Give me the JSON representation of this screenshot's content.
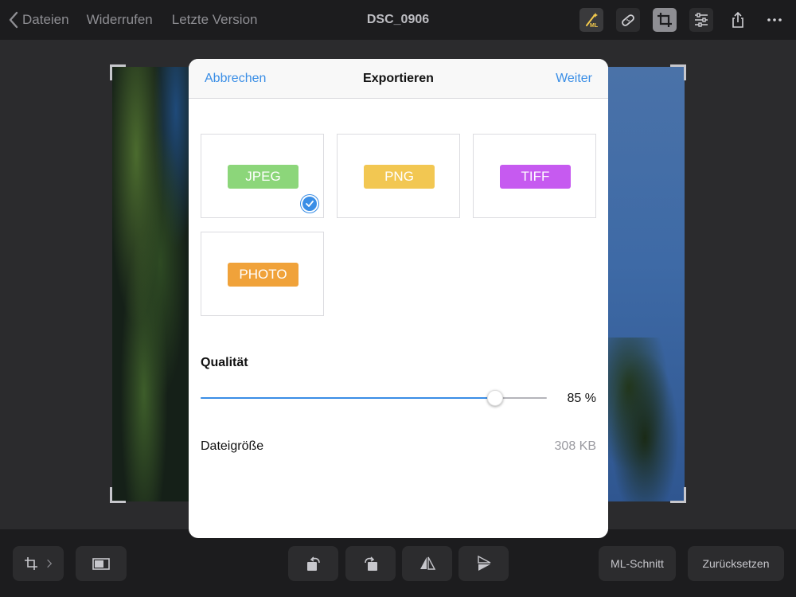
{
  "topbar": {
    "back_label": "Dateien",
    "undo_label": "Widerrufen",
    "version_label": "Letzte Version",
    "title": "DSC_0906",
    "icons": [
      "magic-ml-icon",
      "bandage-icon",
      "crop-icon",
      "adjustments-icon",
      "share-icon",
      "more-icon"
    ],
    "ml_badge": "ML"
  },
  "bottombar": {
    "ml_cut_label": "ML-Schnitt",
    "reset_label": "Zurücksetzen"
  },
  "modal": {
    "cancel_label": "Abbrechen",
    "title": "Exportieren",
    "next_label": "Weiter",
    "formats": [
      {
        "label": "JPEG",
        "color": "#8cd67a",
        "selected": true
      },
      {
        "label": "PNG",
        "color": "#f2c752",
        "selected": false
      },
      {
        "label": "TIFF",
        "color": "#c65af0",
        "selected": false
      },
      {
        "label": "PHOTO",
        "color": "#f0a23a",
        "selected": false
      }
    ],
    "quality_label": "Qualität",
    "quality_value": 85,
    "quality_text": "85 %",
    "filesize_label": "Dateigröße",
    "filesize_value": "308 KB"
  },
  "colors": {
    "accent": "#3a8ee6",
    "background": "#1c1c1e"
  }
}
